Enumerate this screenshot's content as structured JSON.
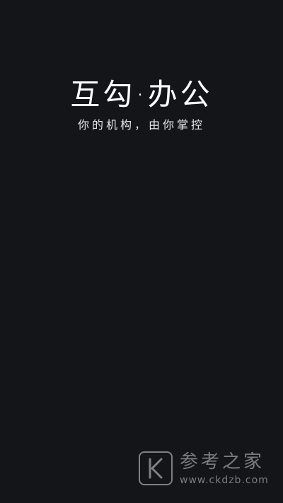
{
  "splash": {
    "app_title": "互勾·办公",
    "tagline": "你的机构，由你掌控"
  },
  "watermark": {
    "logo_letter": "K",
    "name": "参考之家",
    "url": "www.ckdzb.com"
  },
  "colors": {
    "background": "#141518",
    "title_text": "#ffffff",
    "watermark": "#d0d0d0"
  }
}
